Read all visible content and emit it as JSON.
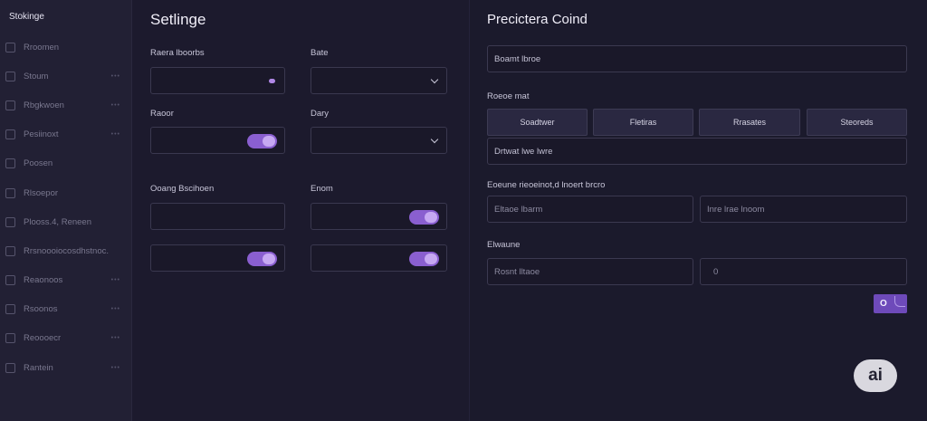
{
  "sidebar": {
    "title": "Stokinge",
    "items": [
      {
        "label": "Rroomen",
        "badge": ""
      },
      {
        "label": "Stoum",
        "badge": "•••"
      },
      {
        "label": "Rbgkwoen",
        "badge": "•••"
      },
      {
        "label": "Pesiinoxt",
        "badge": "•••"
      },
      {
        "label": "Poosen",
        "badge": ""
      },
      {
        "label": "Rlsoepor",
        "badge": ""
      },
      {
        "label": "Plooss.4, Reneen",
        "badge": ""
      },
      {
        "label": "Rrsnoooiocosdhstnoc.",
        "badge": ""
      },
      {
        "label": "Reaonoos",
        "badge": "•••"
      },
      {
        "label": "Rsoonos",
        "badge": "•••"
      },
      {
        "label": "Reoooecr",
        "badge": "•••"
      },
      {
        "label": "Rantein",
        "badge": "•••"
      }
    ]
  },
  "settings": {
    "title": "Setlinge",
    "labels": {
      "field1": "Raera lboorbs",
      "field2": "Bate",
      "field3": "Raoor",
      "field4": "Dary",
      "field5": "Ooang Bscihoen",
      "field6": "Enom"
    }
  },
  "form": {
    "title": "Precictera Coind",
    "top_input_value": "Boamt lbroe",
    "section1_label": "Roeoe mat",
    "segments": [
      "Soadtwer",
      "Fletiras",
      "Rrasates",
      "Steoreds"
    ],
    "input2_value": "Drtwat lwe lwre",
    "section2_label": "Eoeune rieoeinot,d lnoert brcro",
    "input3a_value": "Eltaoe lbarm",
    "input3b_value": "Inre lrae lnoom",
    "section3_label": "Elwaune",
    "input4a_value": "Rosnt lltaoe",
    "input4b_value": "0",
    "submit_glyph": "O"
  },
  "badge": {
    "text": "ai"
  },
  "colors": {
    "accent": "#8a5fd0",
    "background": "#1c1a2e"
  }
}
